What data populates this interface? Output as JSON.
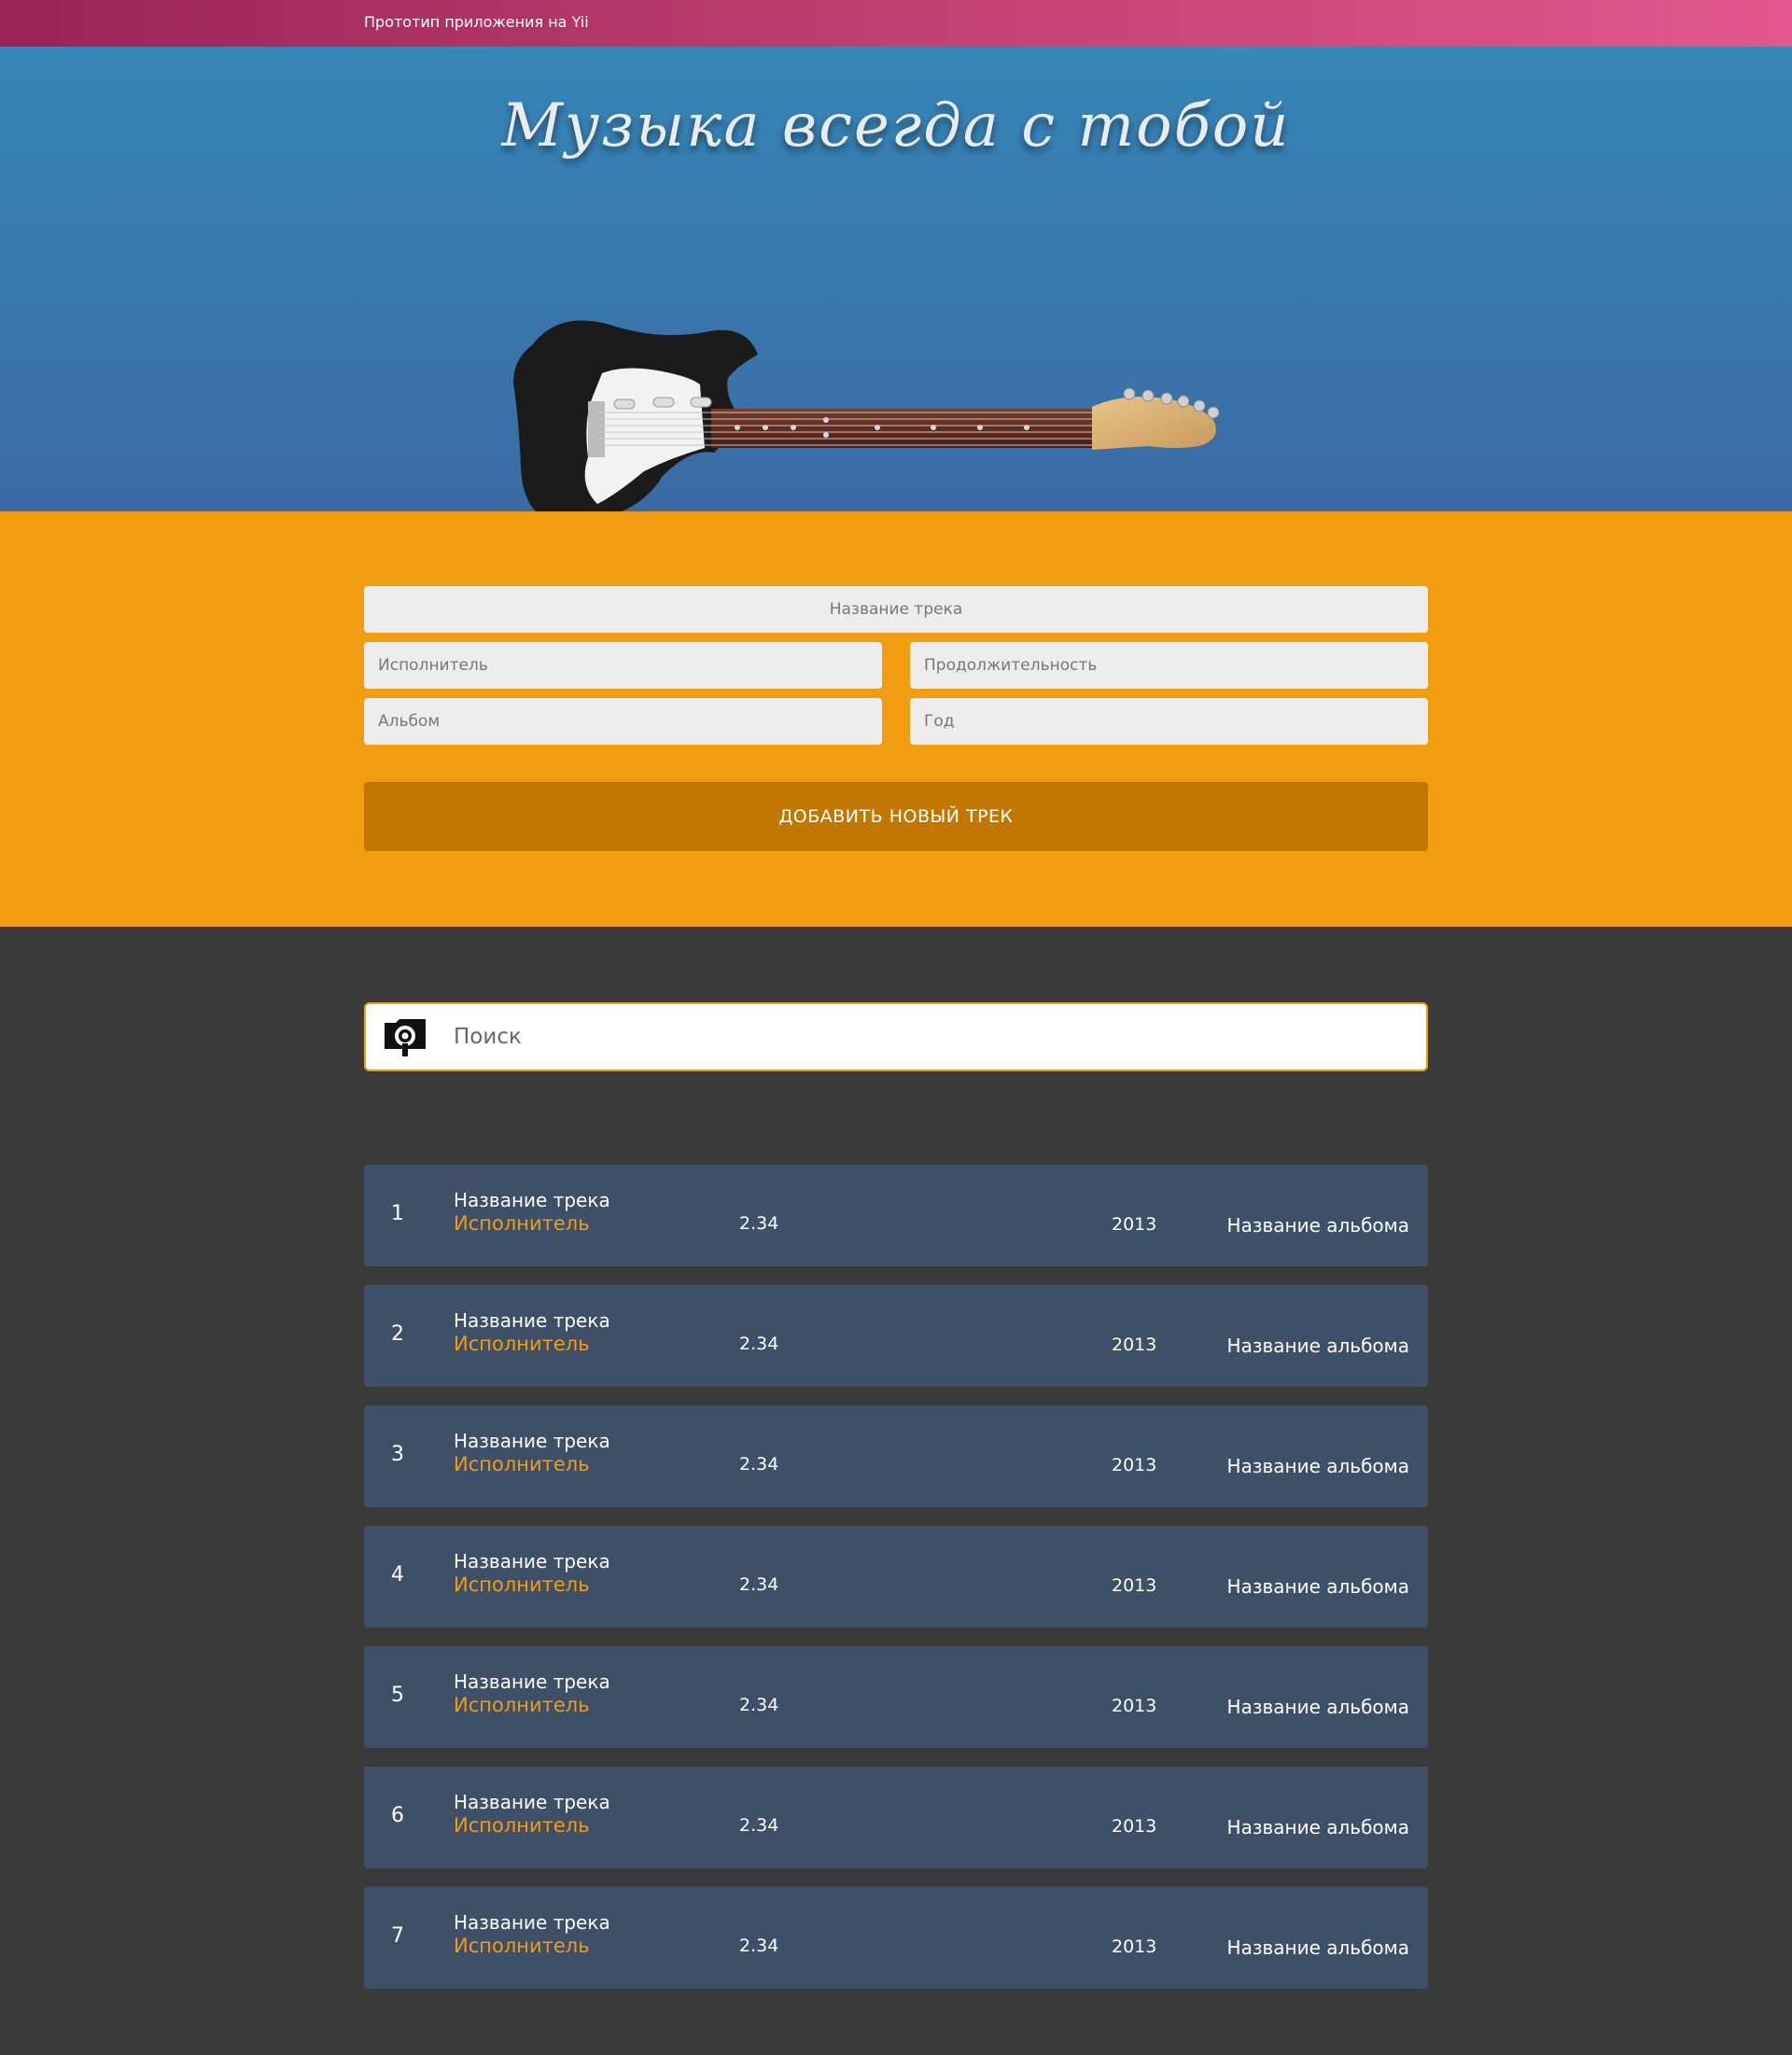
{
  "header": {
    "brand": "Прототип приложения на Yii"
  },
  "hero": {
    "title": "Музыка всегда с тобой"
  },
  "form": {
    "track_name_placeholder": "Название трека",
    "artist_placeholder": "Исполнитель",
    "duration_placeholder": "Продолжительность",
    "album_placeholder": "Альбом",
    "year_placeholder": "Год",
    "add_button_label": "ДОБАВИТЬ НОВЫЙ ТРЕК"
  },
  "search": {
    "placeholder": "Поиск",
    "icon": "search-icon"
  },
  "tracks": [
    {
      "num": "1",
      "title": "Название трека",
      "artist": "Исполнитель",
      "duration": "2.34",
      "year": "2013",
      "album": "Название альбома"
    },
    {
      "num": "2",
      "title": "Название трека",
      "artist": "Исполнитель",
      "duration": "2.34",
      "year": "2013",
      "album": "Название альбома"
    },
    {
      "num": "3",
      "title": "Название трека",
      "artist": "Исполнитель",
      "duration": "2.34",
      "year": "2013",
      "album": "Название альбома"
    },
    {
      "num": "4",
      "title": "Название трека",
      "artist": "Исполнитель",
      "duration": "2.34",
      "year": "2013",
      "album": "Название альбома"
    },
    {
      "num": "5",
      "title": "Название трека",
      "artist": "Исполнитель",
      "duration": "2.34",
      "year": "2013",
      "album": "Название альбома"
    },
    {
      "num": "6",
      "title": "Название трека",
      "artist": "Исполнитель",
      "duration": "2.34",
      "year": "2013",
      "album": "Название альбома"
    },
    {
      "num": "7",
      "title": "Название трека",
      "artist": "Исполнитель",
      "duration": "2.34",
      "year": "2013",
      "album": "Название альбома"
    }
  ],
  "colors": {
    "topbar_start": "#9c2257",
    "topbar_end": "#e2588c",
    "hero": "#3a78af",
    "form_bg": "#f29c12",
    "button": "#c27800",
    "page_bg": "#3a3a3a",
    "row_bg": "#3d5067",
    "artist_accent": "#f29c12"
  }
}
